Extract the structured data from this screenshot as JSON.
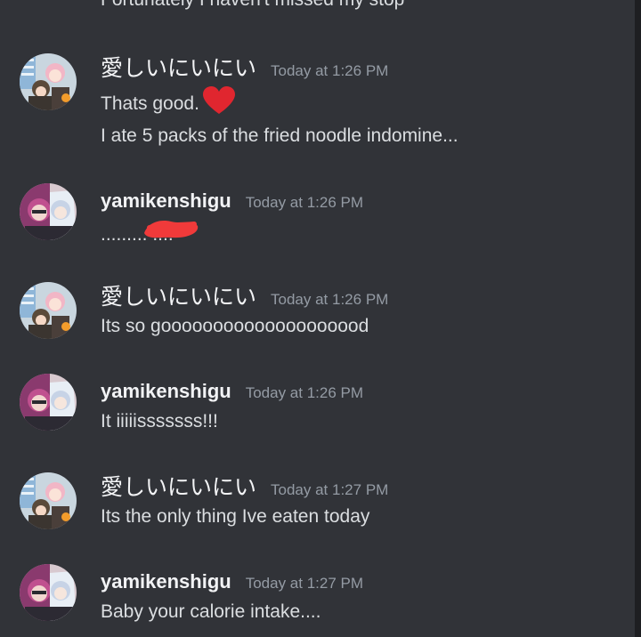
{
  "messages": [
    {
      "text": "Fortunately I haven't missed my stop"
    },
    {
      "author": "愛しいにいにい",
      "timestamp": "Today at 1:26 PM",
      "lines": [
        "Thats good.",
        "I ate 5 packs of the fried noodle indomine..."
      ],
      "emoji": "red-heart"
    },
    {
      "author": "yamikenshigu",
      "timestamp": "Today at 1:26 PM",
      "text": "......... ...."
    },
    {
      "author": "愛しいにいにい",
      "timestamp": "Today at 1:26 PM",
      "text": "Its so goooooooooooooooooood"
    },
    {
      "author": "yamikenshigu",
      "timestamp": "Today at 1:26 PM",
      "text": "It iiiiisssssss!!!"
    },
    {
      "author": "愛しいにいにい",
      "timestamp": "Today at 1:27 PM",
      "text": "Its the only thing Ive eaten today"
    },
    {
      "author": "yamikenshigu",
      "timestamp": "Today at 1:27 PM",
      "text": "Baby your calorie intake...."
    }
  ],
  "colors": {
    "background": "#313338",
    "text": "#dbdee1",
    "username": "#f2f3f5",
    "timestamp": "#949ba4",
    "heart": "#e0262f",
    "redaction": "#f03a3a"
  }
}
